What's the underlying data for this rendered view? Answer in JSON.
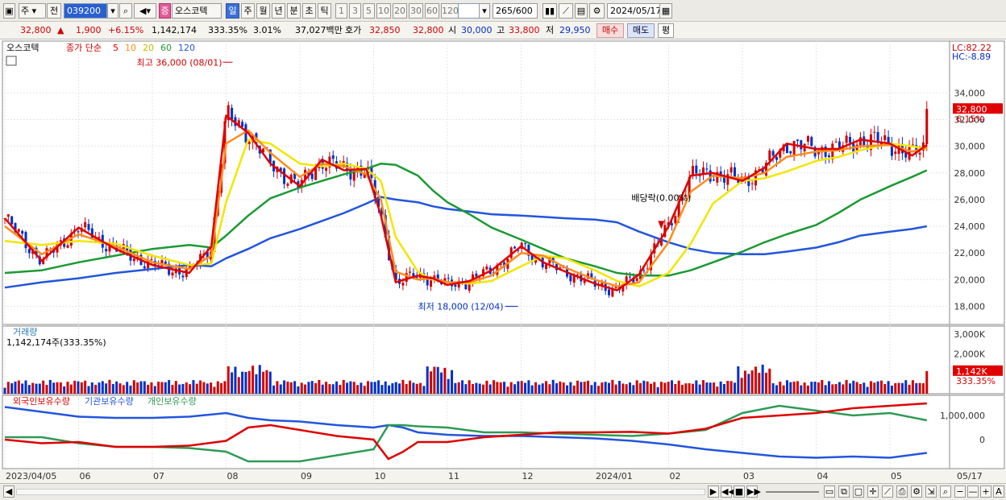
{
  "toolbar": {
    "mode": "주",
    "prev_label": "전",
    "code": "039200",
    "market_badge": "증",
    "stock_name": "오스코텍",
    "periods": [
      "일",
      "주",
      "월",
      "년",
      "분",
      "초",
      "틱"
    ],
    "active_period": "일",
    "minutes": [
      "1",
      "3",
      "5",
      "10",
      "20",
      "30",
      "60",
      "120"
    ],
    "count": "265",
    "count_total": "/600",
    "date": "2024/05/17"
  },
  "quote": {
    "price": "32,800",
    "arrow": "▲",
    "change": "1,900",
    "change_pct": "+6.15%",
    "volume": "1,142,174",
    "volume_ratio": "333.35%",
    "turnover": "3.01%",
    "amount": "37,027백만",
    "ask_label": "호가",
    "ask": "32,850",
    "bid": "32,800",
    "open_label": "시",
    "open": "30,000",
    "high_label": "고",
    "high": "33,800",
    "low_label": "저",
    "low": "29,950",
    "buy_label": "매수",
    "sell_label": "매도",
    "avg_label": "평"
  },
  "colors": {
    "up": "#d20000",
    "down": "#0030c8",
    "ma5": "#e00000",
    "ma10": "#ff8c1a",
    "ma20": "#f2e600",
    "ma60": "#1a9a33",
    "ma120": "#2255dd",
    "foreign": "#e00000",
    "inst": "#2255dd",
    "indiv": "#2e9a55"
  },
  "chart_data": {
    "type": "line",
    "title": "오스코텍",
    "price_legend": {
      "label": "종가 단순",
      "periods": [
        "5",
        "10",
        "20",
        "60",
        "120"
      ]
    },
    "price_axis": {
      "ticks": [
        "34,000",
        "32,000",
        "30,000",
        "28,000",
        "26,000",
        "24,000",
        "22,000",
        "20,000",
        "18,000"
      ],
      "ylim": [
        17000,
        36800
      ]
    },
    "lc": "LC:82.22",
    "hc": "HC:-8.89",
    "last_price_tag": "32,800",
    "last_pct_tag": "6.15%",
    "annotations": {
      "high": "최고 36,000 (08/01)",
      "low": "최저 18,000 (12/04)",
      "dividend": "배당락(0.00%)"
    },
    "x_labels": [
      "2023/04/05",
      "06",
      "07",
      "08",
      "09",
      "10",
      "11",
      "12",
      "2024/01",
      "02",
      "03",
      "04",
      "05",
      "05/17"
    ],
    "x_label_months": [
      0,
      1,
      2,
      3,
      4,
      5,
      6,
      7,
      8,
      9,
      10,
      11,
      12,
      13.5
    ],
    "ma": {
      "months": [
        0,
        0.5,
        1,
        1.5,
        2,
        2.5,
        2.8,
        3,
        3.3,
        3.6,
        4,
        4.3,
        4.6,
        4.9,
        5.1,
        5.3,
        5.6,
        5.8,
        6,
        6.3,
        6.6,
        7,
        7.3,
        7.6,
        8,
        8.3,
        8.6,
        9,
        9.3,
        9.6,
        10,
        10.3,
        10.6,
        11,
        11.3,
        11.6,
        12,
        12.3,
        12.5
      ],
      "ma5": [
        24600,
        21400,
        23900,
        22300,
        21100,
        20500,
        22500,
        32300,
        31000,
        28700,
        27000,
        29000,
        28200,
        28300,
        24800,
        19800,
        20300,
        20100,
        19600,
        19900,
        20700,
        22500,
        21300,
        20600,
        19700,
        19200,
        20400,
        24000,
        27800,
        28000,
        27400,
        28400,
        30200,
        29800,
        29800,
        30500,
        30200,
        29300,
        30100
      ],
      "ma10": [
        24000,
        21900,
        23400,
        22500,
        21300,
        20800,
        21800,
        30200,
        31200,
        29500,
        27700,
        28700,
        28500,
        27900,
        26000,
        20600,
        20000,
        20100,
        19800,
        19800,
        20300,
        22000,
        21800,
        20900,
        20000,
        19500,
        19800,
        22800,
        26600,
        27800,
        27600,
        28000,
        29200,
        29600,
        29700,
        30000,
        30100,
        29600,
        29900
      ],
      "ma20": [
        22900,
        22600,
        22900,
        22700,
        21800,
        21100,
        21200,
        25800,
        30500,
        30200,
        28700,
        28500,
        28700,
        28300,
        27400,
        23200,
        20600,
        20000,
        19800,
        19700,
        19900,
        21000,
        21800,
        21600,
        20700,
        19900,
        19500,
        20500,
        22700,
        25700,
        27400,
        27600,
        28100,
        28900,
        29200,
        29700,
        30200,
        30000,
        29800
      ],
      "ma60": [
        20500,
        20700,
        21300,
        21800,
        22300,
        22600,
        22400,
        23300,
        24800,
        26100,
        26900,
        27400,
        27900,
        28300,
        28700,
        28600,
        27800,
        26700,
        25800,
        24900,
        23900,
        23000,
        22300,
        21600,
        21000,
        20500,
        20300,
        20300,
        20700,
        21300,
        22100,
        22800,
        23400,
        24100,
        25000,
        26000,
        27000,
        27700,
        28200
      ],
      "ma120": [
        19400,
        19800,
        20100,
        20500,
        20800,
        21100,
        21000,
        21600,
        22300,
        23100,
        23800,
        24400,
        25000,
        25700,
        26200,
        26000,
        25800,
        25500,
        25300,
        25100,
        24900,
        24800,
        24700,
        24600,
        24500,
        24300,
        23600,
        22800,
        22300,
        22000,
        21900,
        21900,
        22100,
        22400,
        22800,
        23300,
        23600,
        23800,
        24000
      ]
    },
    "extremes": {
      "high": 36000,
      "high_month": 3.0,
      "low": 18000,
      "low_month": 7.0,
      "dividend_month": 8.9
    },
    "volume": {
      "title": "거래량",
      "value_label": "1,142,174주(333.35%)",
      "axis_ticks": [
        "3,000K",
        "2,000K"
      ],
      "last_tag": "1,142K",
      "last_pct": "333.35%",
      "ylim": [
        0,
        3000000
      ]
    },
    "holdings": {
      "legend": [
        "외국인보유수량",
        "기관보유수량",
        "개인보유수량"
      ],
      "axis_ticks": [
        "1,000,000",
        "0"
      ],
      "months": [
        0,
        0.5,
        1,
        1.5,
        2,
        2.5,
        3,
        3.3,
        3.6,
        4,
        4.5,
        5,
        5.2,
        5.4,
        5.6,
        6,
        6.5,
        7,
        7.5,
        8,
        8.5,
        9,
        9.5,
        10,
        10.5,
        11,
        11.5,
        12,
        12.5
      ],
      "foreign": [
        0,
        -150000,
        -100000,
        -300000,
        -300000,
        -250000,
        -50000,
        500000,
        600000,
        400000,
        150000,
        0,
        -800000,
        -500000,
        -100000,
        -100000,
        100000,
        200000,
        300000,
        300000,
        320000,
        250000,
        450000,
        900000,
        1000000,
        1100000,
        1300000,
        1400000,
        1500000
      ],
      "inst": [
        1350000,
        1150000,
        950000,
        900000,
        900000,
        950000,
        1100000,
        900000,
        800000,
        750000,
        600000,
        500000,
        600000,
        500000,
        300000,
        200000,
        150000,
        150000,
        100000,
        50000,
        -50000,
        -200000,
        -400000,
        -550000,
        -700000,
        -750000,
        -700000,
        -750000,
        -550000
      ],
      "indiv": [
        100000,
        100000,
        -150000,
        -300000,
        -300000,
        -350000,
        -500000,
        -900000,
        -900000,
        -900000,
        -650000,
        -400000,
        600000,
        600000,
        550000,
        500000,
        300000,
        300000,
        250000,
        200000,
        150000,
        250000,
        400000,
        1100000,
        1400000,
        1200000,
        1000000,
        1100000,
        800000
      ]
    }
  },
  "statusbar": {
    "right_label": "A"
  }
}
